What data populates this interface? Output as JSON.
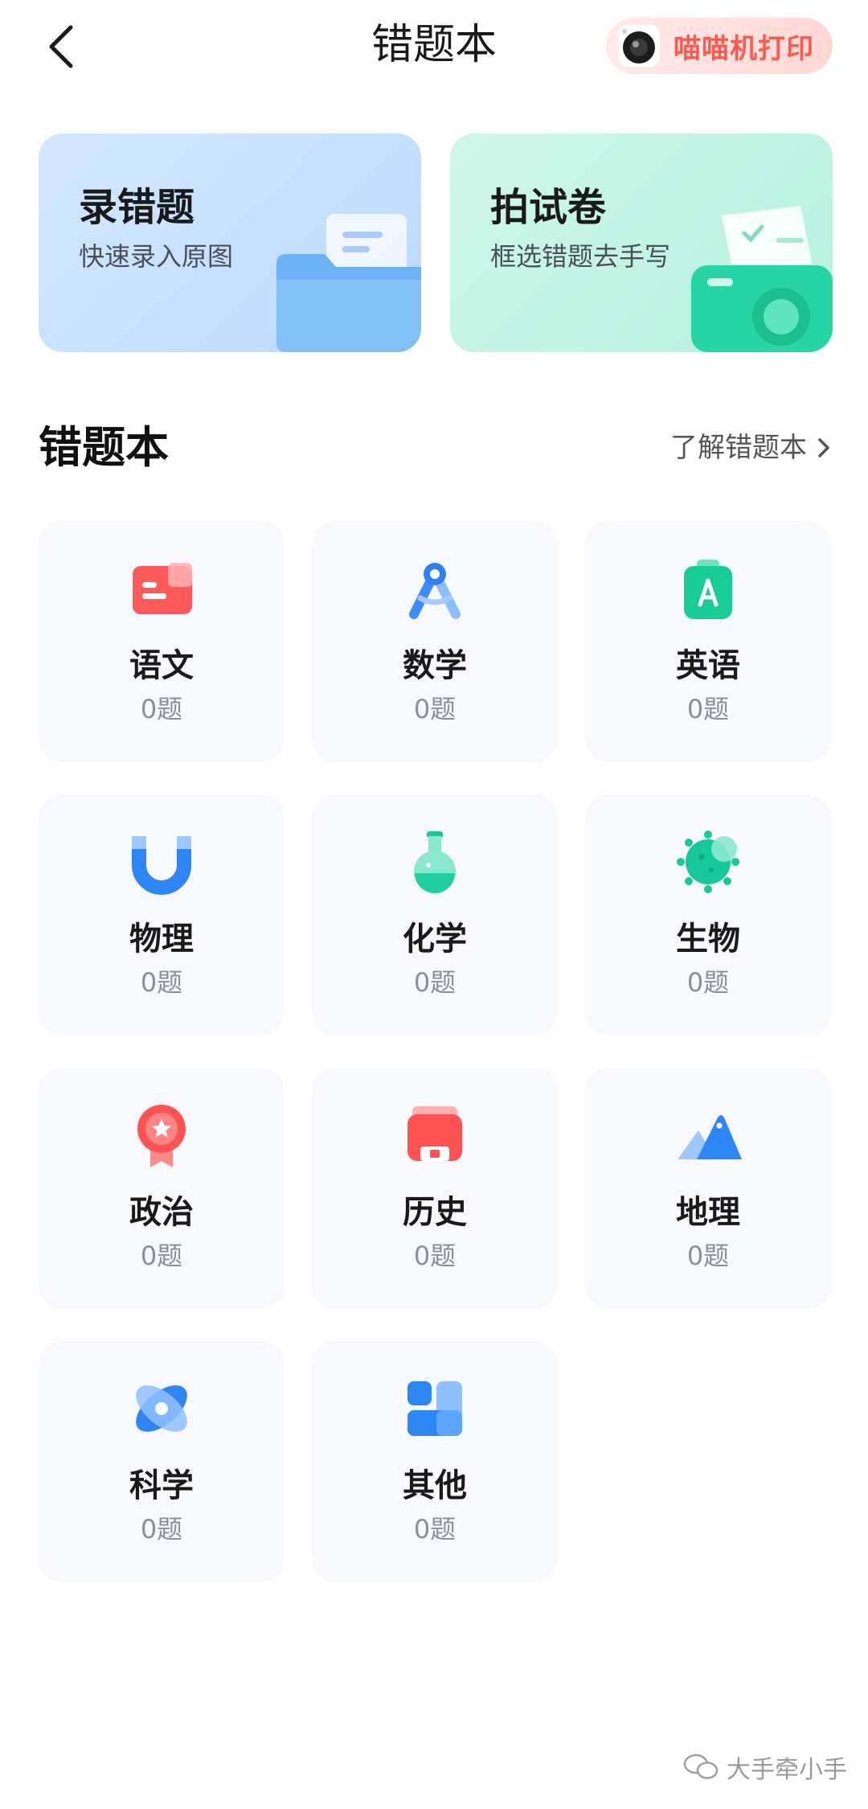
{
  "header": {
    "title": "错题本",
    "print_label": "喵喵机打印"
  },
  "actions": {
    "record": {
      "title": "录错题",
      "subtitle": "快速录入原图"
    },
    "scan": {
      "title": "拍试卷",
      "subtitle": "框选错题去手写"
    }
  },
  "section": {
    "title": "错题本",
    "learn_link": "了解错题本"
  },
  "subjects": [
    {
      "name": "语文",
      "count": "0题",
      "icon": "chinese-book-icon"
    },
    {
      "name": "数学",
      "count": "0题",
      "icon": "compass-icon"
    },
    {
      "name": "英语",
      "count": "0题",
      "icon": "english-a-icon"
    },
    {
      "name": "物理",
      "count": "0题",
      "icon": "magnet-icon"
    },
    {
      "name": "化学",
      "count": "0题",
      "icon": "flask-icon"
    },
    {
      "name": "生物",
      "count": "0题",
      "icon": "cell-icon"
    },
    {
      "name": "政治",
      "count": "0题",
      "icon": "badge-star-icon"
    },
    {
      "name": "历史",
      "count": "0题",
      "icon": "scroll-icon"
    },
    {
      "name": "地理",
      "count": "0题",
      "icon": "mountain-icon"
    },
    {
      "name": "科学",
      "count": "0题",
      "icon": "atom-icon"
    },
    {
      "name": "其他",
      "count": "0题",
      "icon": "blocks-icon"
    }
  ],
  "watermark": "大手牵小手"
}
